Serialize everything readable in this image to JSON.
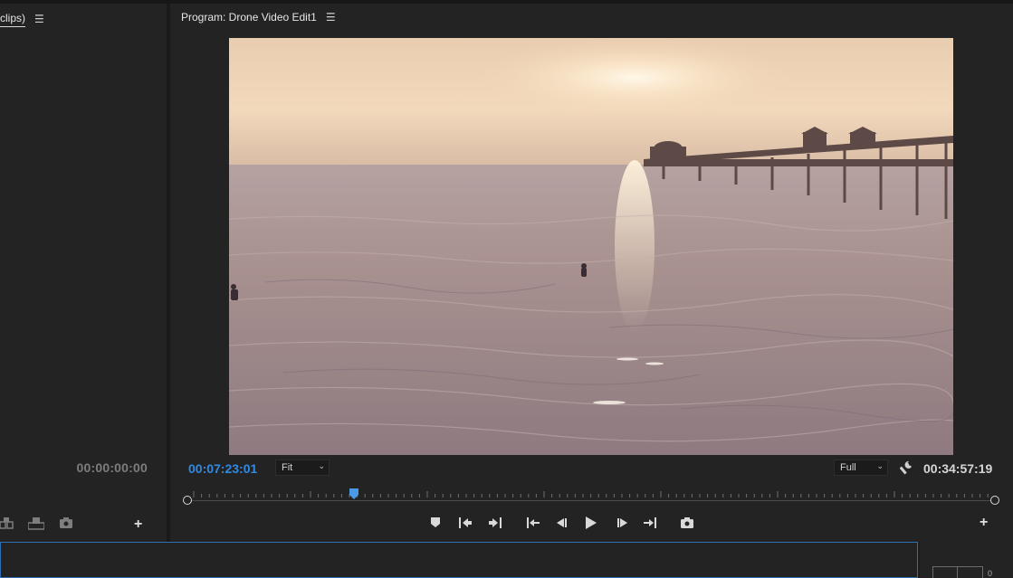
{
  "source_panel": {
    "tab_label": "clips)",
    "timecode": "00:00:00:00"
  },
  "program_monitor": {
    "title": "Program: Drone Video Edit1",
    "current_timecode": "00:07:23:01",
    "zoom_select": "Fit",
    "resolution_select": "Full",
    "duration_timecode": "00:34:57:19",
    "playhead_position": 0.206
  },
  "audio_meter": {
    "zero_label": "0"
  },
  "colors": {
    "accent_blue": "#2f8ae3",
    "panel_bg": "#232323",
    "selected_panel_border": "#2f6fb1"
  },
  "icons": {
    "source_bottom": [
      "insert-icon",
      "overwrite-icon",
      "export-frame-icon",
      "add-button-icon"
    ],
    "transport": [
      "add-marker-icon",
      "mark-in-icon",
      "mark-out-icon",
      "go-to-in-icon",
      "step-back-icon",
      "play-icon",
      "step-forward-icon",
      "go-to-out-icon",
      "export-frame-icon",
      "button-editor-icon"
    ]
  }
}
